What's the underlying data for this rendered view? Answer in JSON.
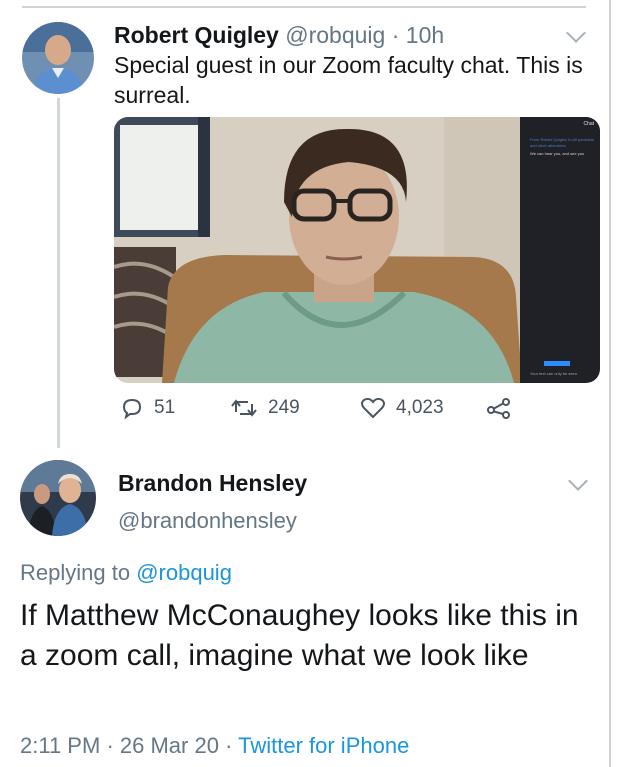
{
  "tweet": {
    "author_name": "Robert Quigley",
    "author_handle": "@robquig",
    "separator": "·",
    "time_ago": "10h",
    "text": "Special guest in our Zoom faculty chat. This is surreal.",
    "media": {
      "chat_header": "Chat",
      "chat_lines": [
        "From Robert Quigley to All panelists and other attendees",
        "We can hear you, and see you"
      ],
      "chat_bottom_hint": "Your text can only be seen"
    },
    "actions": {
      "replies": "51",
      "retweets": "249",
      "likes": "4,023"
    }
  },
  "reply": {
    "author_name": "Brandon Hensley",
    "author_handle": "@brandonhensley",
    "replying_prefix": "Replying to",
    "replying_to": "@robquig",
    "text": "If Matthew McConaughey looks like this in a zoom call, imagine what we look like",
    "time": "2:11 PM",
    "dot1": "·",
    "date": "26 Mar 20",
    "dot2": "·",
    "source": "Twitter for iPhone"
  },
  "icons": {
    "reply": "reply-icon",
    "retweet": "retweet-icon",
    "like": "heart-icon",
    "share": "share-icon",
    "more": "chevron-down-icon"
  },
  "colors": {
    "link": "#1b95e0",
    "muted": "#657786"
  }
}
